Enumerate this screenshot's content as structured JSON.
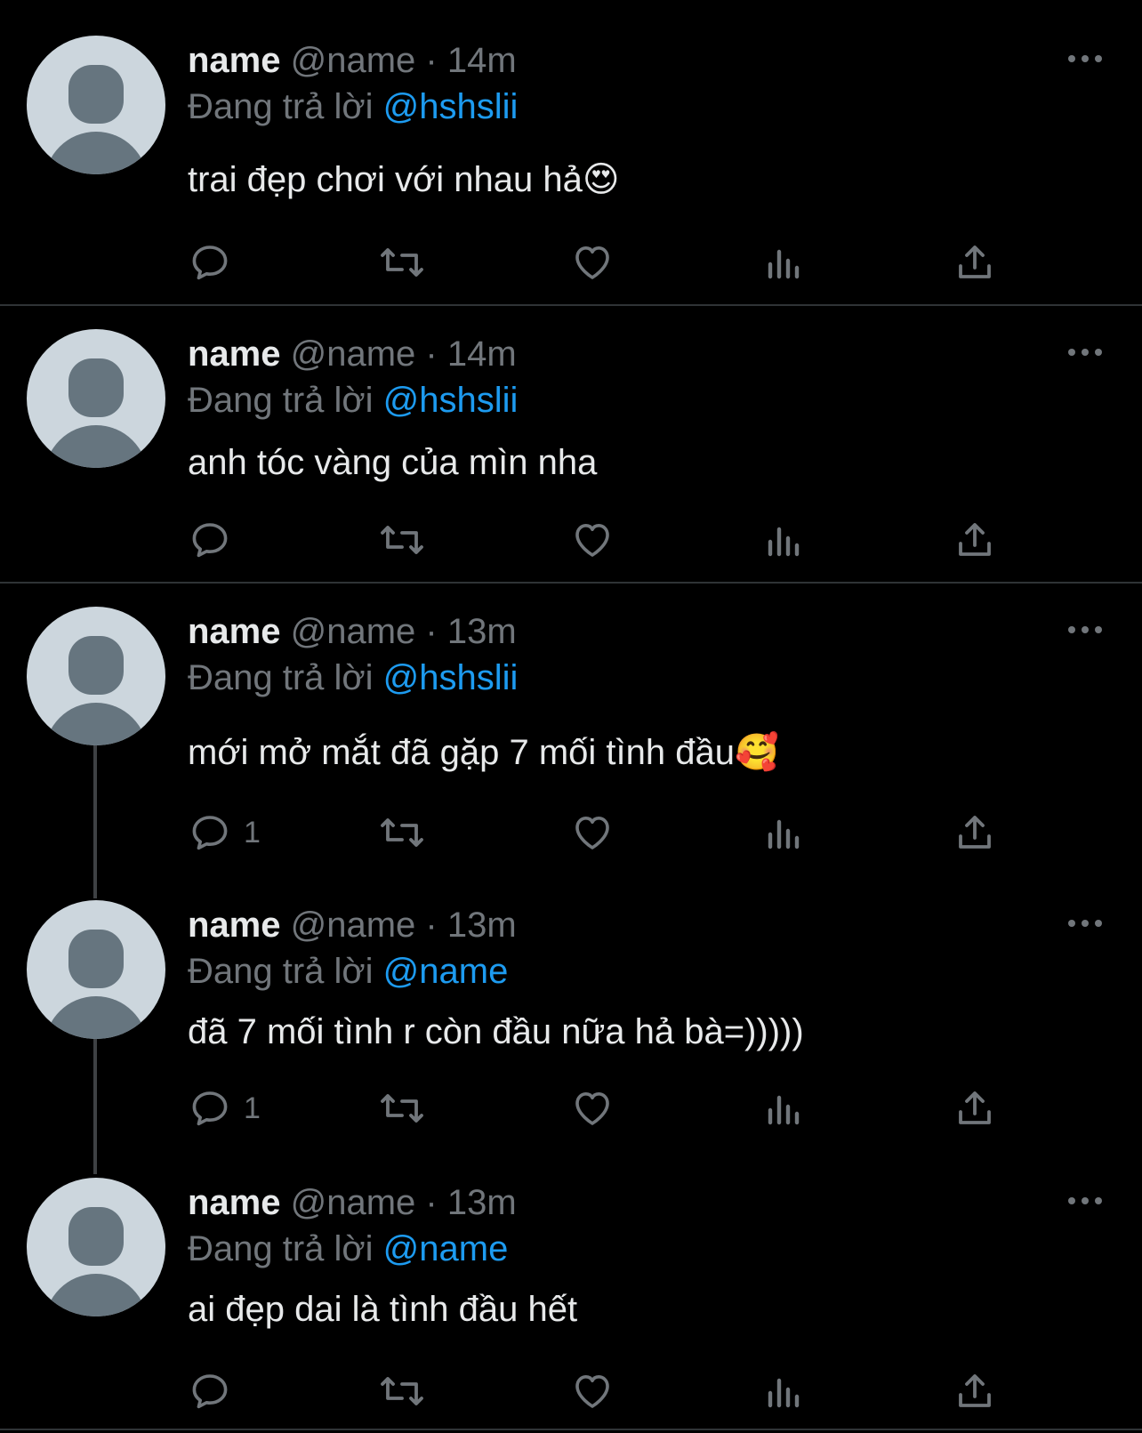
{
  "tweets": [
    {
      "name": "name",
      "handle": "@name",
      "separator": "·",
      "time": "14m",
      "replying_label": "Đang trả lời",
      "replying_to": "@hshslii",
      "text": "trai đẹp chơi với nhau hả😍",
      "reply_count": ""
    },
    {
      "name": "name",
      "handle": "@name",
      "separator": "·",
      "time": "14m",
      "replying_label": "Đang trả lời",
      "replying_to": "@hshslii",
      "text": "anh tóc vàng của mìn nha",
      "reply_count": ""
    },
    {
      "name": "name",
      "handle": "@name",
      "separator": "·",
      "time": "13m",
      "replying_label": "Đang trả lời",
      "replying_to": "@hshslii",
      "text": "mới mở mắt đã gặp 7 mối tình đầu🥰",
      "reply_count": "1"
    },
    {
      "name": "name",
      "handle": "@name",
      "separator": "·",
      "time": "13m",
      "replying_label": "Đang trả lời",
      "replying_to": "@name",
      "text": "đã 7 mối tình r còn đầu nữa hả bà=)))))",
      "reply_count": "1"
    },
    {
      "name": "name",
      "handle": "@name",
      "separator": "·",
      "time": "13m",
      "replying_label": "Đang trả lời",
      "replying_to": "@name",
      "text": "ai đẹp dai là tình đầu hết",
      "reply_count": ""
    }
  ],
  "icons": {
    "more": "more-horizontal-icon",
    "reply": "reply-bubble-icon",
    "retweet": "retweet-icon",
    "like": "heart-icon",
    "views": "views-bar-chart-icon",
    "share": "share-upload-icon"
  },
  "colors": {
    "background": "#000000",
    "text": "#e7e9ea",
    "secondary": "#71767b",
    "mention": "#1d9bf0",
    "divider": "#2f3336",
    "avatar_bg": "#ccd6dd",
    "avatar_fg": "#66757f"
  }
}
